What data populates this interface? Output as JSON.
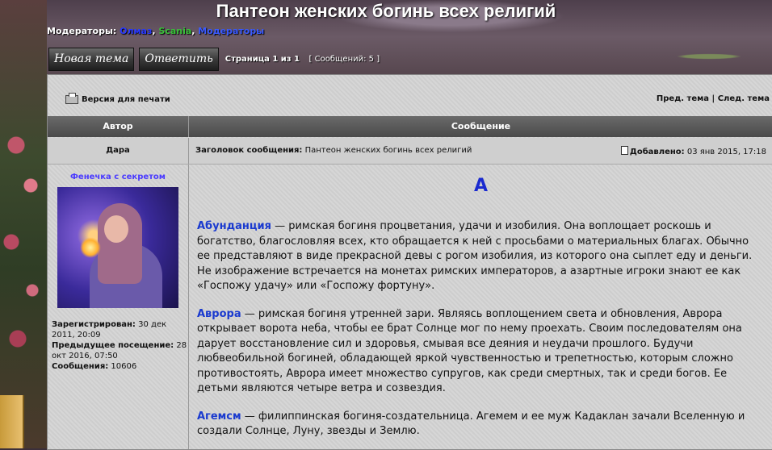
{
  "header": {
    "title": "Пантеон женских богинь всех религий",
    "moderators_label": "Модераторы: ",
    "moderators": [
      "Олмаз",
      "Scania",
      "Модераторы"
    ],
    "separators": [
      ", ",
      ", "
    ]
  },
  "toolbar": {
    "new_topic": "Новая тема",
    "reply": "Ответить",
    "page_info": "Страница 1 из 1",
    "messages_count": "[ Сообщений: 5 ]"
  },
  "topic_nav": {
    "print_version": "Версия для печати",
    "prev": "Пред. тема",
    "sep": " | ",
    "next": "След. тема"
  },
  "table": {
    "col_author": "Автор",
    "col_message": "Сообщение"
  },
  "post": {
    "author": "Дара",
    "subject_label": "Заголовок сообщения:",
    "subject": "Пантеон женских богинь всех религий",
    "posted_label": "Добавлено:",
    "posted": "03 янв 2015, 17:18",
    "rank": "Фенечка с секретом",
    "registered_label": "Зарегистрирован:",
    "registered": "30 дек 2011, 20:09",
    "last_visit_label": "Предыдущее посещение:",
    "last_visit": "28 окт 2016, 07:50",
    "posts_label": "Сообщения:",
    "posts": "10606",
    "letter": "А",
    "entries": [
      {
        "name": "Абунданция",
        "text": " — римская богиня процветания, удачи и изобилия. Она воплощает роскошь и богатство, благословляя всех, кто обращается к ней с просьбами о материальных благах. Обычно ее представляют в виде прекрасной девы с рогом изобилия, из которого она сыплет еду и деньги. Не изображение встречается на монетах римских императоров, а азартные игроки знают ее как «Госпожу удачу» или «Госпожу фортуну»."
      },
      {
        "name": "Аврора",
        "text": " — римская богиня утренней зари. Являясь воплощением света и обновления, Аврора открывает ворота неба, чтобы ее брат Солнце мог по нему проехать. Своим последователям она дарует восстановление сил и здоровья, смывая все деяния и неудачи прошлого. Будучи любвеобильной богиней, обладающей яркой чувственностью и трепетностью, которым сложно противостоять, Аврора имеет множество супругов, как среди смертных, так и среди богов. Ее детьми являются четыре ветра и созвездия."
      },
      {
        "name": "Агемсм",
        "text": " — филиппинская богиня-создательница. Агемем и ее муж Кадаклан зачали Вселенную и создали Солнце, Луну, звезды и Землю."
      }
    ]
  }
}
